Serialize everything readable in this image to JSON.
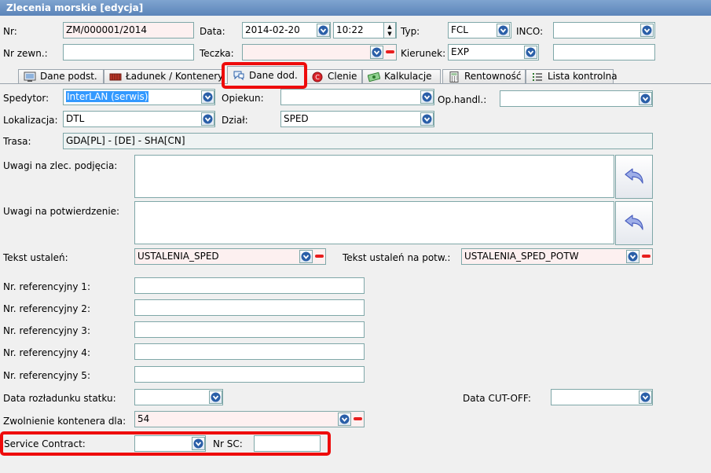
{
  "window": {
    "title": "Zlecenia morskie  [edycja]"
  },
  "header": {
    "nr_label": "Nr:",
    "nr_value": "ZM/000001/2014",
    "data_label": "Data:",
    "data_value": "2014-02-20",
    "time_value": "10:22",
    "typ_label": "Typ:",
    "typ_value": "FCL",
    "inco_label": "INCO:",
    "inco_value": "",
    "nr_zewn_label": "Nr zewn.:",
    "nr_zewn_value": "",
    "teczka_label": "Teczka:",
    "teczka_value": "",
    "kierunek_label": "Kierunek:",
    "kierunek_value": "EXP",
    "kierunek_extra_value": ""
  },
  "tabs": [
    {
      "label": "Dane podst.",
      "icon": "monitor-icon"
    },
    {
      "label": "Ładunek / Kontenery",
      "icon": "container-icon"
    },
    {
      "label": "Dane dod.",
      "icon": "speech-bubble-icon"
    },
    {
      "label": "Clenie",
      "icon": "customs-stamp-icon"
    },
    {
      "label": "Kalkulacje",
      "icon": "money-icon"
    },
    {
      "label": "Rentowność",
      "icon": "calculator-icon"
    },
    {
      "label": "Lista kontrolna",
      "icon": "checklist-icon"
    }
  ],
  "active_tab": "Dane dod.",
  "form": {
    "spedytor_label": "Spedytor:",
    "spedytor_value": "InterLAN (serwis)",
    "opiekun_label": "Opiekun:",
    "opiekun_value": "",
    "op_handl_label": "Op.handl.:",
    "op_handl_value": "",
    "lokalizacja_label": "Lokalizacja:",
    "lokalizacja_value": "DTL",
    "dzial_label": "Dział:",
    "dzial_value": "SPED",
    "trasa_label": "Trasa:",
    "trasa_value": "GDA[PL] - [DE] - SHA[CN]",
    "uwagi_zlec_label": "Uwagi na zlec. podjęcia:",
    "uwagi_zlec_value": "",
    "uwagi_potw_label": "Uwagi na potwierdzenie:",
    "uwagi_potw_value": "",
    "tekst_ustalen_label": "Tekst ustaleń:",
    "tekst_ustalen_value": "USTALENIA_SPED",
    "tekst_ustalen_potw_label": "Tekst ustaleń na potw.:",
    "tekst_ustalen_potw_value": "USTALENIA_SPED_POTW",
    "nr_ref": [
      {
        "label": "Nr. referencyjny 1:",
        "value": ""
      },
      {
        "label": "Nr. referencyjny 2:",
        "value": ""
      },
      {
        "label": "Nr. referencyjny 3:",
        "value": ""
      },
      {
        "label": "Nr. referencyjny 4:",
        "value": ""
      },
      {
        "label": "Nr. referencyjny 5:",
        "value": ""
      }
    ],
    "data_rozladunku_label": "Data rozładunku statku:",
    "data_rozladunku_value": "",
    "data_cutoff_label": "Data CUT-OFF:",
    "data_cutoff_value": "",
    "zwolnienie_label": "Zwolnienie kontenera dla:",
    "zwolnienie_value": "54",
    "service_contract_label": "Service Contract:",
    "service_contract_value": "",
    "nr_sc_label": "Nr SC:",
    "nr_sc_value": ""
  },
  "colors": {
    "title_bar": "#5b84b9",
    "highlight": "#ee0b0b",
    "field_border": "#7fa7a8",
    "readonly_field": "#fdf0f0"
  }
}
